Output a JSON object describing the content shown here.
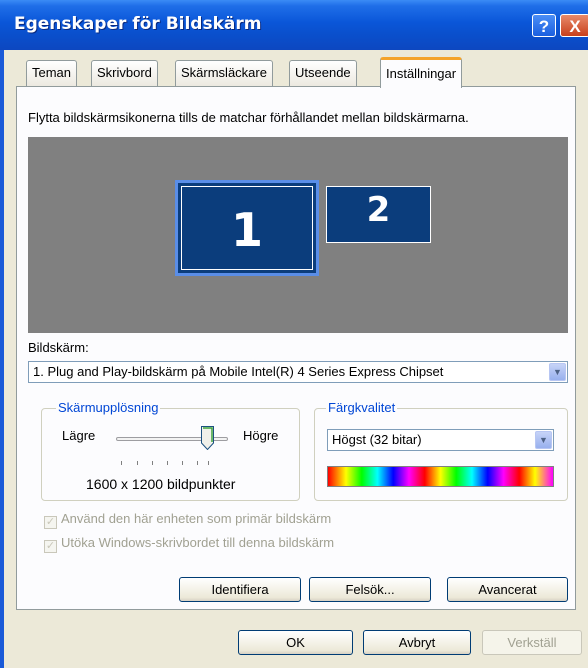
{
  "window": {
    "title": "Egenskaper för Bildskärm",
    "help_label": "?",
    "close_label": "X"
  },
  "tabs": [
    {
      "label": "Teman",
      "active": false
    },
    {
      "label": "Skrivbord",
      "active": false
    },
    {
      "label": "Skärmsläckare",
      "active": false
    },
    {
      "label": "Utseende",
      "active": false
    },
    {
      "label": "Inställningar",
      "active": true
    }
  ],
  "settings": {
    "instruction": "Flytta bildskärmsikonerna tills de matchar förhållandet mellan bildskärmarna.",
    "monitors": [
      {
        "number": "1",
        "selected": true
      },
      {
        "number": "2",
        "selected": false
      }
    ],
    "display_label": "Bildskärm:",
    "display_value": "1. Plug and Play-bildskärm på Mobile Intel(R) 4 Series Express Chipset",
    "resolution": {
      "group_title": "Skärmupplösning",
      "low_label": "Lägre",
      "high_label": "Högre",
      "value": "1600 x 1200 bildpunkter",
      "slider_level": 0.8
    },
    "color": {
      "group_title": "Färgkvalitet",
      "value": "Högst (32 bitar)"
    },
    "checkboxes": [
      {
        "label": "Använd den här enheten som primär bildskärm",
        "checked": true,
        "enabled": false
      },
      {
        "label": "Utöka Windows-skrivbordet till denna bildskärm",
        "checked": true,
        "enabled": false
      }
    ],
    "buttons": {
      "identify": "Identifiera",
      "troubleshoot": "Felsök...",
      "advanced": "Avancerat"
    }
  },
  "dialog_buttons": {
    "ok": "OK",
    "cancel": "Avbryt",
    "apply": "Verkställ"
  },
  "colors": {
    "title_bar": "#0a56d8",
    "monitor_fill": "#0b3d7c",
    "preview_bg": "#808080",
    "active_tab_accent": "#f4a32a",
    "group_title": "#0046d5"
  }
}
